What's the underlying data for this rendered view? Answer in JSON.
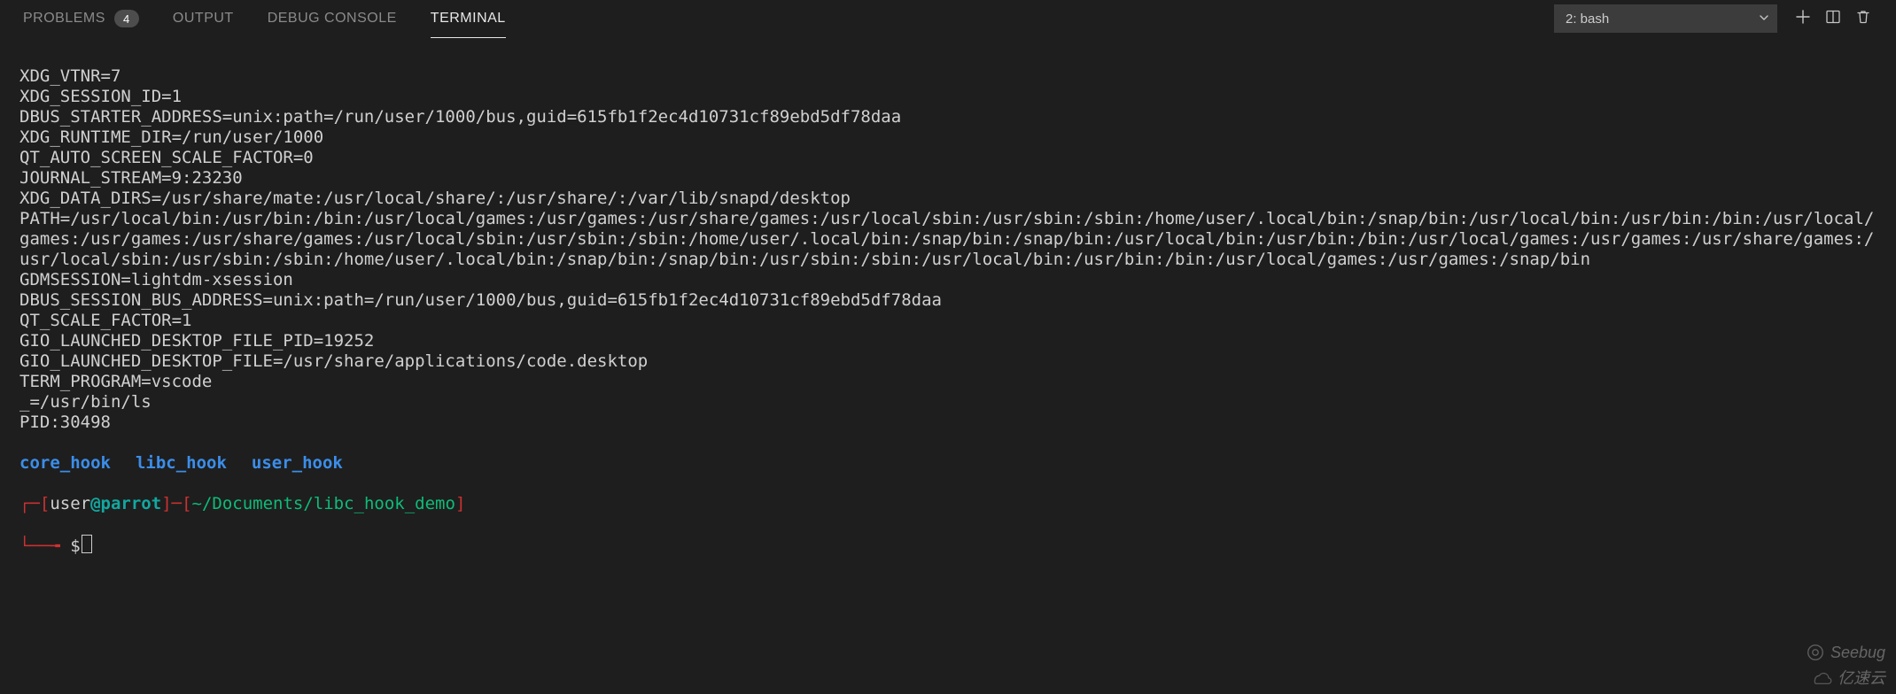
{
  "tabs": {
    "problems": {
      "label": "PROBLEMS",
      "badge": "4"
    },
    "output": {
      "label": "OUTPUT"
    },
    "debug": {
      "label": "DEBUG CONSOLE"
    },
    "terminal": {
      "label": "TERMINAL"
    }
  },
  "terminal_selector": {
    "label": "2: bash"
  },
  "env_lines": [
    "XDG_VTNR=7",
    "XDG_SESSION_ID=1",
    "DBUS_STARTER_ADDRESS=unix:path=/run/user/1000/bus,guid=615fb1f2ec4d10731cf89ebd5df78daa",
    "XDG_RUNTIME_DIR=/run/user/1000",
    "QT_AUTO_SCREEN_SCALE_FACTOR=0",
    "JOURNAL_STREAM=9:23230",
    "XDG_DATA_DIRS=/usr/share/mate:/usr/local/share/:/usr/share/:/var/lib/snapd/desktop",
    "PATH=/usr/local/bin:/usr/bin:/bin:/usr/local/games:/usr/games:/usr/share/games:/usr/local/sbin:/usr/sbin:/sbin:/home/user/.local/bin:/snap/bin:/usr/local/bin:/usr/bin:/bin:/usr/local/games:/usr/games:/usr/share/games:/usr/local/sbin:/usr/sbin:/sbin:/home/user/.local/bin:/snap/bin:/snap/bin:/usr/local/bin:/usr/bin:/bin:/usr/local/games:/usr/games:/usr/share/games:/usr/local/sbin:/usr/sbin:/sbin:/home/user/.local/bin:/snap/bin:/snap/bin:/usr/sbin:/sbin:/usr/local/bin:/usr/bin:/bin:/usr/local/games:/usr/games:/snap/bin",
    "GDMSESSION=lightdm-xsession",
    "DBUS_SESSION_BUS_ADDRESS=unix:path=/run/user/1000/bus,guid=615fb1f2ec4d10731cf89ebd5df78daa",
    "QT_SCALE_FACTOR=1",
    "GIO_LAUNCHED_DESKTOP_FILE_PID=19252",
    "GIO_LAUNCHED_DESKTOP_FILE=/usr/share/applications/code.desktop",
    "TERM_PROGRAM=vscode",
    "_=/usr/bin/ls",
    "PID:30498"
  ],
  "dirs": [
    "core_hook",
    "libc_hook",
    "user_hook"
  ],
  "prompt": {
    "open1": "┌─[",
    "user": "user",
    "at": "@",
    "host": "parrot",
    "close1": "]─[",
    "cwd": "~/Documents/libc_hook_demo",
    "close2": "]",
    "line2_prefix": "└──╼ ",
    "dollar": "$"
  },
  "watermarks": {
    "top": "Seebug",
    "bottom": "亿速云"
  }
}
